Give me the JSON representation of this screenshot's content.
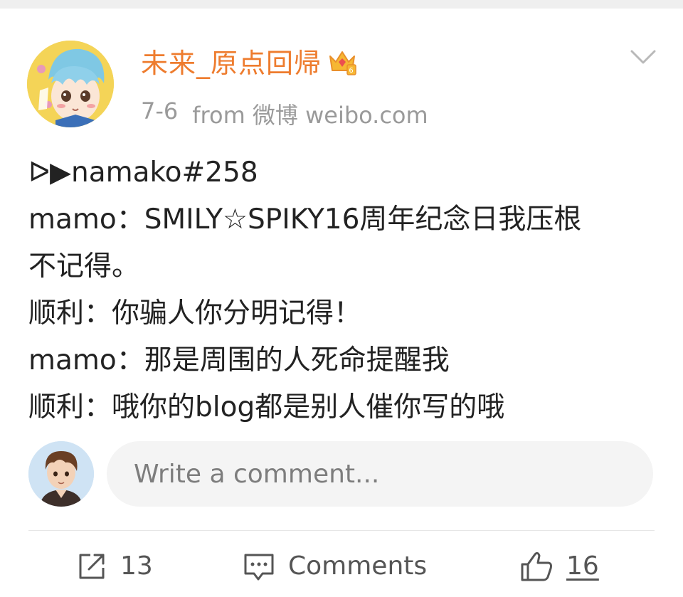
{
  "post": {
    "author": {
      "name": "未来_原点回帰"
    },
    "date": "7-6",
    "source": "from 微博 weibo.com",
    "lines": [
      "ᐅ▶namako#258",
      "mamo：SMILY☆SPIKY16周年纪念日我压根",
      "不记得。",
      "顺利：你骗人你分明记得！",
      "mamo：那是周围的人死命提醒我",
      "顺利：哦你的blog都是别人催你写的哦"
    ]
  },
  "comment_box": {
    "placeholder": "Write a comment..."
  },
  "actions": {
    "repost_count": "13",
    "comment_label": "Comments",
    "like_count": "16"
  },
  "colors": {
    "username": "#ee7c2e",
    "meta": "#9a9a9a",
    "input_bg": "#f4f4f4"
  },
  "icons": {
    "vip": "crown-icon",
    "menu": "chevron-down-icon",
    "repost": "share-icon",
    "comment": "comment-icon",
    "like": "thumbs-up-icon"
  }
}
